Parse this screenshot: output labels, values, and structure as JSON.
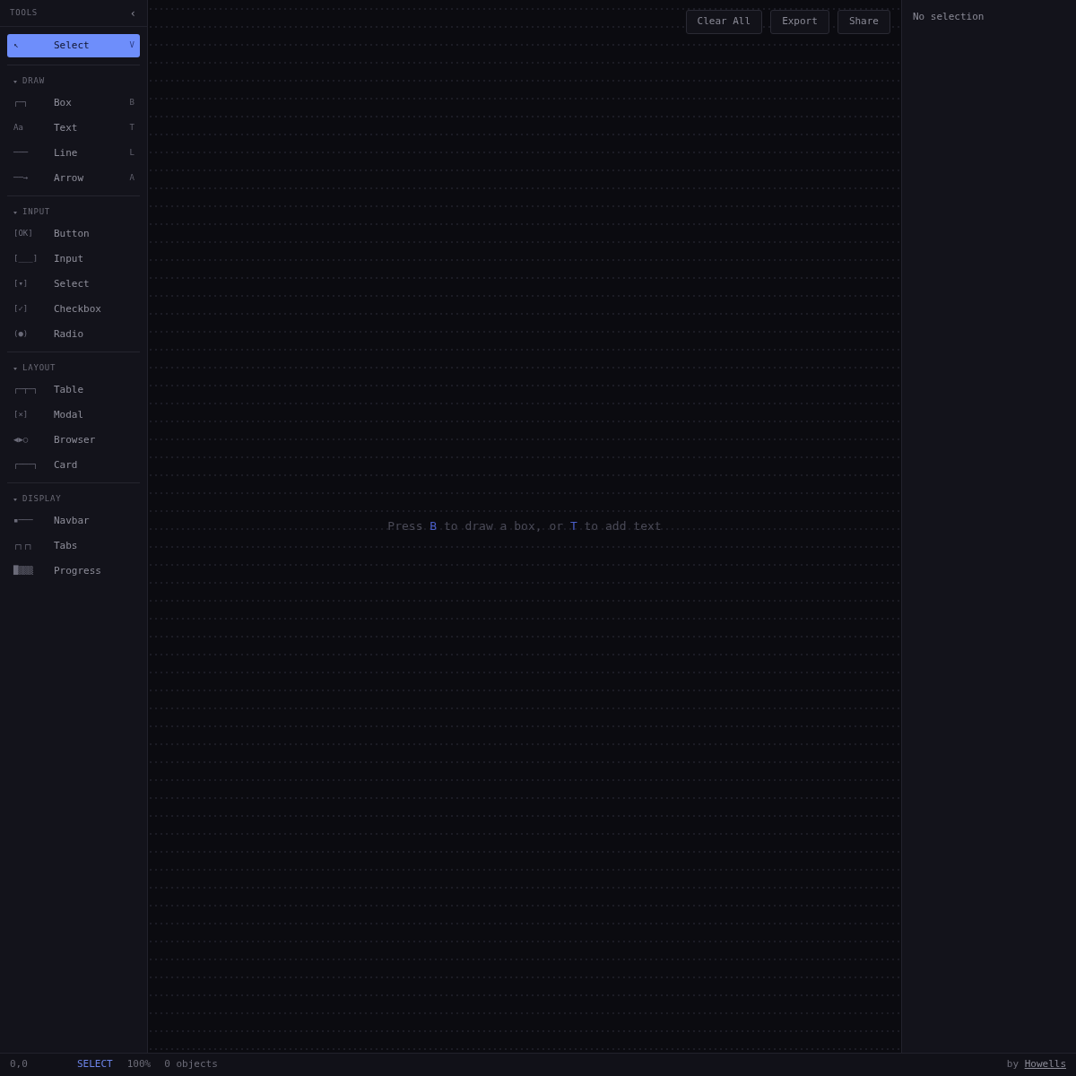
{
  "sidebar": {
    "title": "TOOLS",
    "collapse_button": "‹",
    "tools": [
      {
        "glyph": "↖",
        "label": "Select",
        "shortcut": "V",
        "selected": true
      }
    ],
    "sections": [
      {
        "title": "DRAW",
        "expanded": true,
        "tools": [
          {
            "glyph": "┌─┐",
            "label": "Box",
            "shortcut": "B",
            "selected": false
          },
          {
            "glyph": "Aa",
            "label": "Text",
            "shortcut": "T",
            "selected": false
          },
          {
            "glyph": "───",
            "label": "Line",
            "shortcut": "L",
            "selected": false
          },
          {
            "glyph": "──→",
            "label": "Arrow",
            "shortcut": "A",
            "selected": false
          }
        ]
      },
      {
        "title": "INPUT",
        "expanded": true,
        "tools": [
          {
            "glyph": "[OK]",
            "label": "Button",
            "selected": false
          },
          {
            "glyph": "[___]",
            "label": "Input",
            "selected": false
          },
          {
            "glyph": "[▾]",
            "label": "Select",
            "selected": false
          },
          {
            "glyph": "[✓]",
            "label": "Checkbox",
            "selected": false
          },
          {
            "glyph": "(●)",
            "label": "Radio",
            "selected": false
          }
        ]
      },
      {
        "title": "LAYOUT",
        "expanded": true,
        "tools": [
          {
            "glyph": "┌─┬─┐",
            "label": "Table",
            "selected": false
          },
          {
            "glyph": "[×]",
            "label": "Modal",
            "selected": false
          },
          {
            "glyph": "◀▶○",
            "label": "Browser",
            "selected": false
          },
          {
            "glyph": "┌───┐",
            "label": "Card",
            "selected": false
          }
        ]
      },
      {
        "title": "DISPLAY",
        "expanded": true,
        "tools": [
          {
            "glyph": "▪───",
            "label": "Navbar",
            "selected": false
          },
          {
            "glyph": "┌┐┌┐",
            "label": "Tabs",
            "selected": false
          },
          {
            "glyph": "█▒▒▒",
            "label": "Progress",
            "selected": false
          }
        ]
      }
    ]
  },
  "canvas": {
    "toolbar": [
      "Clear All",
      "Export",
      "Share"
    ],
    "hint": [
      {
        "text": "Press ",
        "highlight": false
      },
      {
        "text": "B",
        "highlight": true
      },
      {
        "text": " to draw a box, or ",
        "highlight": false
      },
      {
        "text": "T",
        "highlight": true
      },
      {
        "text": " to add text",
        "highlight": false
      }
    ]
  },
  "inspector": {
    "empty_text": "No selection"
  },
  "status_bar": {
    "cursor": "0,0",
    "mode": "SELECT",
    "zoom": "100%",
    "objects": "0 objects",
    "credit": "by",
    "author_link": "Howells"
  }
}
